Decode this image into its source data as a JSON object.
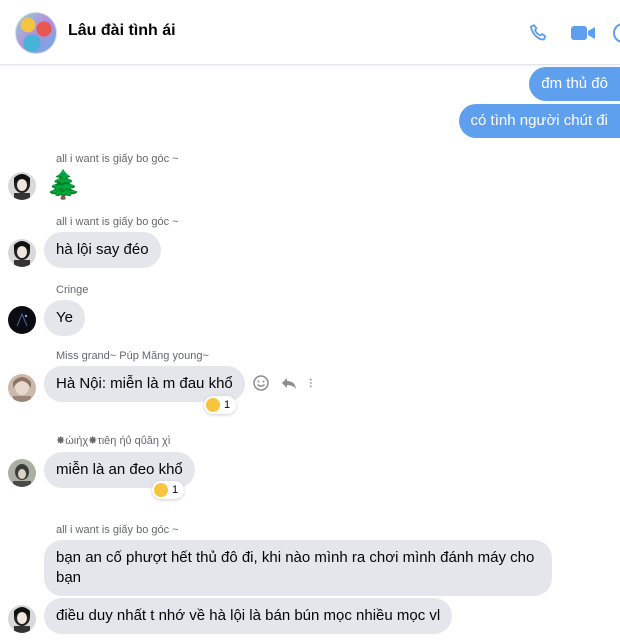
{
  "header": {
    "title": "Lâu đài tình ái",
    "icons": [
      "phone-icon",
      "video-icon",
      "more-icon"
    ],
    "accent": "#5ea0ee"
  },
  "messages": {
    "out1": "đm thủ đô",
    "out2": "có tình người chút đi",
    "m1_sender": "all i want is giấy bo góc ~",
    "m1_text": "🌲",
    "m2_sender": "all i want is giấy bo góc ~",
    "m2_text": "hà lội say đéo",
    "m3_sender": "Cringe",
    "m3_text": "Ye",
    "m4_sender": "Miss grand~ Púp Măng young~",
    "m4_text": "Hà Nội: miễn là m đau khổ",
    "m4_react_count": "1",
    "m5_sender": "✸ώιήχ✸τιêη ήΰ qΰăη χὶ",
    "m5_text": "miễn là an đeo khổ",
    "m5_react_count": "1",
    "m6_sender": "all i want is giấy bo góc ~",
    "m6_text": "bạn an cố phượt hết thủ đô đi, khi nào mình ra chơi mình đánh máy cho bạn",
    "m7_text": "điều duy nhất t nhớ về hà lội là bán bún mọc nhiều mọc vl"
  }
}
